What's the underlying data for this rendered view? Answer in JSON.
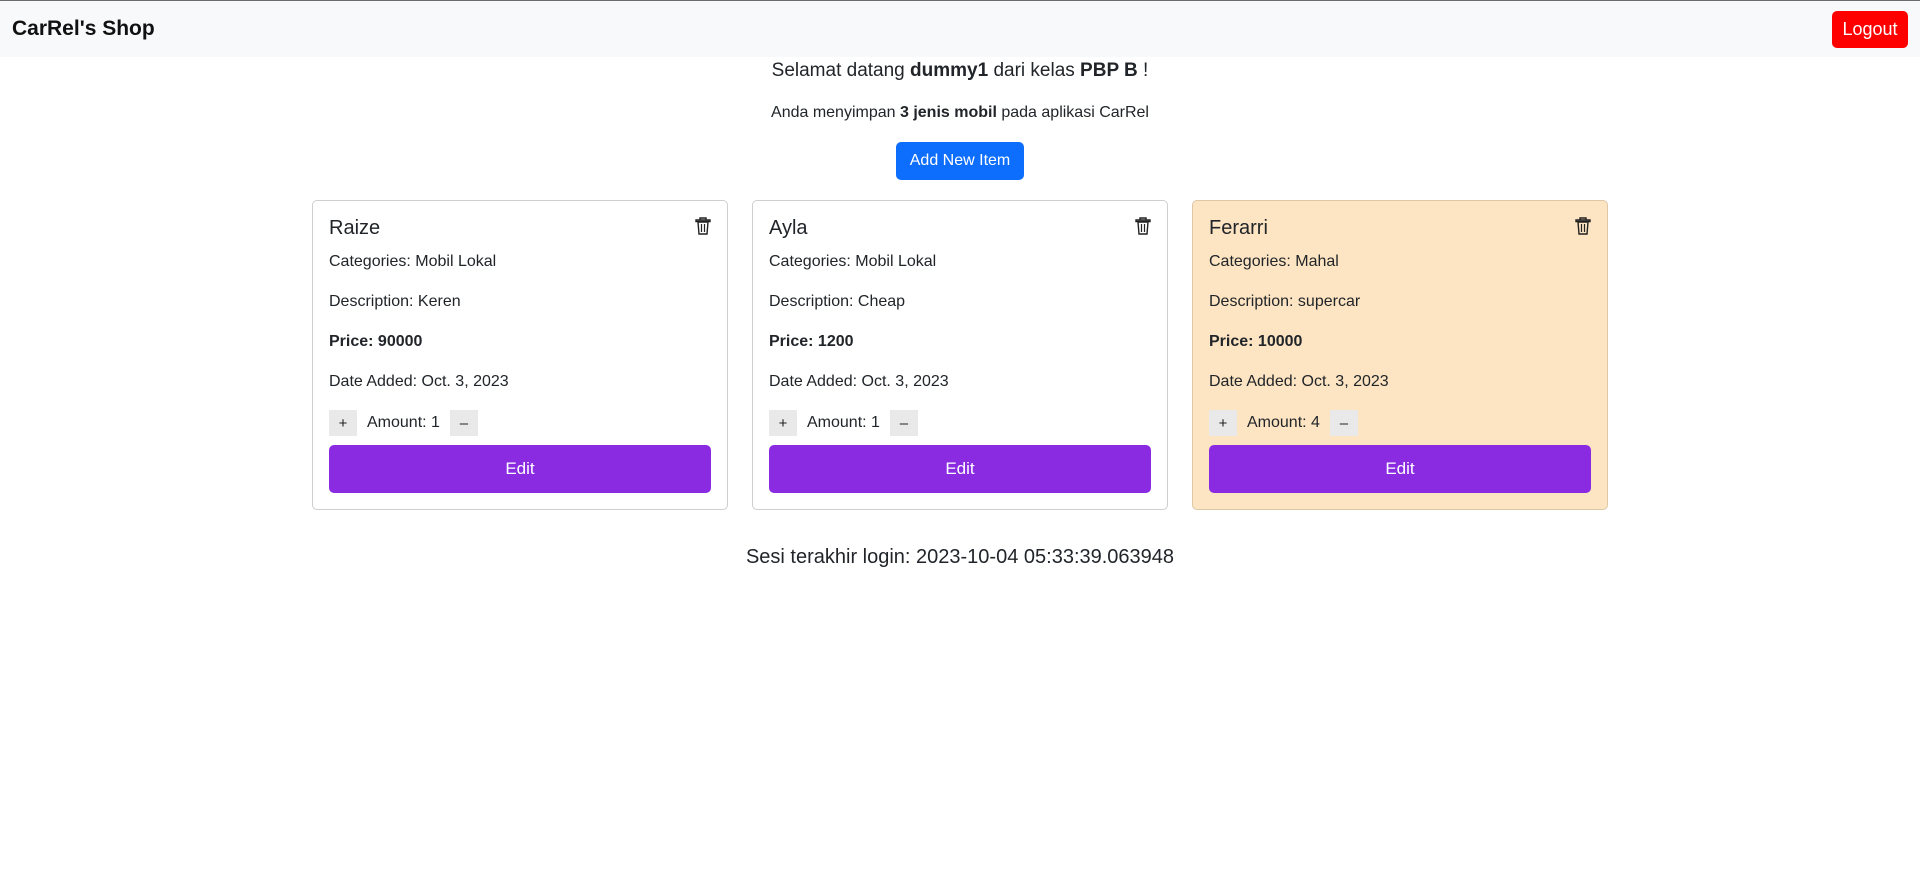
{
  "navbar": {
    "brand": "CarRel's Shop",
    "logout_label": "Logout"
  },
  "welcome": {
    "prefix": "Selamat datang ",
    "username": "dummy1",
    "middle": " dari kelas ",
    "class_name": "PBP B",
    "suffix": " !"
  },
  "info": {
    "prefix": "Anda menyimpan ",
    "count_text": "3 jenis mobil",
    "suffix": " pada aplikasi CarRel"
  },
  "add_button": "Add New Item",
  "items": [
    {
      "name": "Raize",
      "categories": "Categories: Mobil Lokal",
      "description": "Description: Keren",
      "price": "Price: 90000",
      "date": "Date Added: Oct. 3, 2023",
      "amount": "Amount: 1",
      "plus": "+",
      "minus": "–",
      "edit": "Edit",
      "highlighted": false
    },
    {
      "name": "Ayla",
      "categories": "Categories: Mobil Lokal",
      "description": "Description: Cheap",
      "price": "Price: 1200",
      "date": "Date Added: Oct. 3, 2023",
      "amount": "Amount: 1",
      "plus": "+",
      "minus": "–",
      "edit": "Edit",
      "highlighted": false
    },
    {
      "name": "Ferarri",
      "categories": "Categories: Mahal",
      "description": "Description: supercar",
      "price": "Price: 10000",
      "date": "Date Added: Oct. 3, 2023",
      "amount": "Amount: 4",
      "plus": "+",
      "minus": "–",
      "edit": "Edit",
      "highlighted": true
    }
  ],
  "last_login": "Sesi terakhir login: 2023-10-04 05:33:39.063948",
  "colors": {
    "logout": "#ff0000",
    "add": "#0d6efd",
    "edit": "#8a2be2",
    "highlight_card": "#fde4c2"
  },
  "icons": {
    "delete": "trash-icon"
  }
}
